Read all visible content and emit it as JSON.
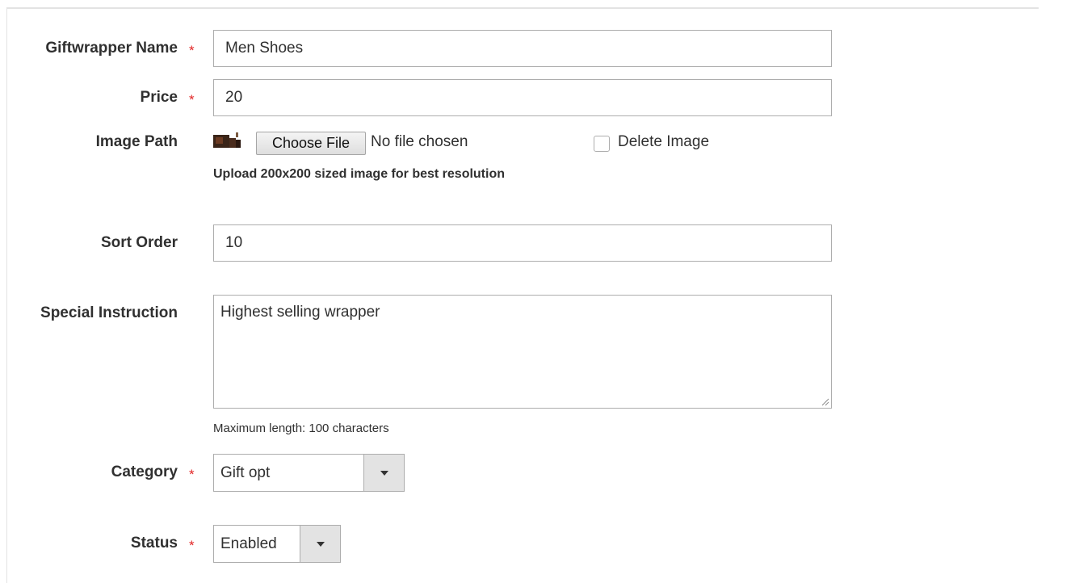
{
  "form": {
    "name": {
      "label": "Giftwrapper Name",
      "required_mark": "*",
      "value": "Men Shoes"
    },
    "price": {
      "label": "Price",
      "required_mark": "*",
      "value": "20"
    },
    "image": {
      "label": "Image Path",
      "thumbnail_icon": "image-thumbnail-icon",
      "choose_button": "Choose File",
      "file_status": "No file chosen",
      "delete_label": "Delete Image",
      "delete_checked": false,
      "hint": "Upload 200x200 sized image for best resolution"
    },
    "sort_order": {
      "label": "Sort Order",
      "value": "10"
    },
    "special_instruction": {
      "label": "Special Instruction",
      "value": "Highest selling wrapper",
      "note": "Maximum length: 100 characters"
    },
    "category": {
      "label": "Category",
      "required_mark": "*",
      "value": "Gift opt"
    },
    "status": {
      "label": "Status",
      "required_mark": "*",
      "value": "Enabled"
    }
  },
  "colors": {
    "required": "#e22626",
    "border": "#adadad",
    "text": "#303030",
    "select_arrow_bg": "#e3e3e3"
  }
}
